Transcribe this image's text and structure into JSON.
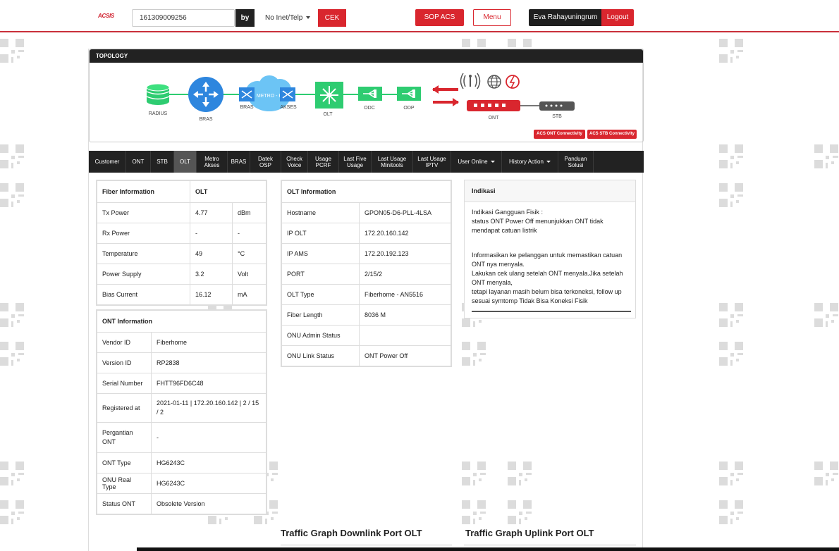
{
  "header": {
    "logo": "ACSIS",
    "search_value": "161309009256",
    "by_label": "by",
    "select_value": "No Inet/Telp",
    "cek_label": "CEK",
    "sop_label": "SOP ACS",
    "menu_label": "Menu",
    "user_name": "Eva Rahayuningrum",
    "logout_label": "Logout"
  },
  "topology": {
    "title": "TOPOLOGY",
    "labels": {
      "radius": "RADIUS",
      "bras": "BRAS",
      "bras2": "BRAS",
      "metro": "METRO - E",
      "akses": "AKSES",
      "olt": "OLT",
      "odc": "ODC",
      "odp": "ODP",
      "ont": "ONT",
      "stb": "STB"
    },
    "acs_ont_btn": "ACS ONT Connectivity",
    "acs_stb_btn": "ACS STB Connectivity",
    "colors": {
      "accent": "#d9262e",
      "green": "#2ecc71",
      "blue": "#2e86de"
    }
  },
  "nav": {
    "items": [
      {
        "label": "Customer"
      },
      {
        "label": "ONT"
      },
      {
        "label": "STB"
      },
      {
        "label": "OLT"
      },
      {
        "label": "Metro Akses"
      },
      {
        "label": "BRAS"
      },
      {
        "label": "Datek OSP"
      },
      {
        "label": "Check Voice"
      },
      {
        "label": "Usage PCRF"
      },
      {
        "label": "Last Five Usage"
      },
      {
        "label": "Last Usage Minitools"
      },
      {
        "label": "Last Usage IPTV"
      },
      {
        "label": "User Online"
      },
      {
        "label": "History Action"
      },
      {
        "label": "Panduan Solusi"
      }
    ]
  },
  "fiber": {
    "header_left": "Fiber Information",
    "header_right": "OLT",
    "rows": [
      {
        "name": "Tx Power",
        "value": "4.77",
        "unit": "dBm"
      },
      {
        "name": "Rx Power",
        "value": "-",
        "unit": "-"
      },
      {
        "name": "Temperature",
        "value": "49",
        "unit": "°C"
      },
      {
        "name": "Power Supply",
        "value": "3.2",
        "unit": "Volt"
      },
      {
        "name": "Bias Current",
        "value": "16.12",
        "unit": "mA"
      }
    ]
  },
  "ont_info": {
    "header": "ONT Information",
    "rows": [
      {
        "name": "Vendor ID",
        "value": "Fiberhome"
      },
      {
        "name": "Version ID",
        "value": "RP2838"
      },
      {
        "name": "Serial Number",
        "value": "FHTT96FD6C48"
      },
      {
        "name": "Registered at",
        "value": "2021-01-11 | 172.20.160.142 | 2 / 15 / 2"
      },
      {
        "name": "Pergantian ONT",
        "value": "-"
      },
      {
        "name": "ONT Type",
        "value": "HG6243C"
      },
      {
        "name": "ONU Real Type",
        "value": "HG6243C"
      },
      {
        "name": "Status ONT",
        "value": "Obsolete Version"
      }
    ]
  },
  "olt_info": {
    "header": "OLT Information",
    "rows": [
      {
        "name": "Hostname",
        "value": "GPON05-D6-PLL-4LSA"
      },
      {
        "name": "IP OLT",
        "value": "172.20.160.142"
      },
      {
        "name": "IP AMS",
        "value": "172.20.192.123"
      },
      {
        "name": "PORT",
        "value": "2/15/2"
      },
      {
        "name": "OLT Type",
        "value": "Fiberhome - AN5516"
      },
      {
        "name": "Fiber Length",
        "value": "8036 M"
      },
      {
        "name": "ONU Admin Status",
        "value": ""
      },
      {
        "name": "ONU Link Status",
        "value": "ONT Power Off"
      }
    ]
  },
  "indikasi": {
    "header": "Indikasi",
    "lines": [
      "Indikasi Gangguan Fisik :",
      "status ONT Power Off menunjukkan ONT tidak mendapat catuan listrik",
      "",
      "Informasikan ke pelanggan untuk memastikan catuan ONT nya menyala.",
      "Lakukan cek ulang setelah ONT menyala.Jika setelah ONT menyala,",
      "tetapi layanan masih belum bisa terkoneksi, follow up sesuai symtomp Tidak Bisa Koneksi Fisik"
    ]
  },
  "graphs": {
    "downlink_title": "Traffic Graph Downlink Port OLT",
    "uplink_title": "Traffic Graph Uplink Port OLT"
  }
}
